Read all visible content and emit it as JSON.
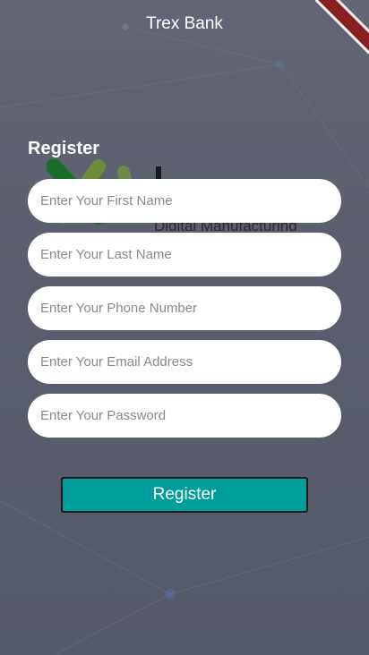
{
  "app": {
    "title": "Trex Bank"
  },
  "logo": {
    "tagline": "Digital Manufacturing"
  },
  "form": {
    "heading": "Register",
    "fields": [
      {
        "placeholder": "Enter Your First Name",
        "value": ""
      },
      {
        "placeholder": "Enter Your Last Name",
        "value": ""
      },
      {
        "placeholder": "Enter Your Phone Number",
        "value": ""
      },
      {
        "placeholder": "Enter Your Email Address",
        "value": ""
      },
      {
        "placeholder": "Enter Your Password",
        "value": ""
      }
    ],
    "submit_label": "Register"
  },
  "colors": {
    "background": "#5e6372",
    "accent": "#009e9a",
    "field_background": "#ffffff",
    "debug_banner": "#8a1f24"
  }
}
